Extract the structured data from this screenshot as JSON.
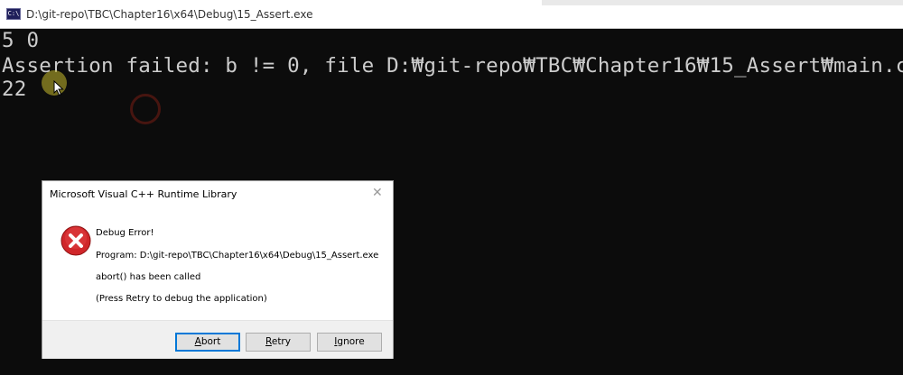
{
  "window": {
    "icon_text": "C:\\",
    "title": "D:\\git-repo\\TBC\\Chapter16\\x64\\Debug\\15_Assert.exe"
  },
  "console": {
    "lines": [
      "5 0",
      "Assertion failed: b != 0, file D:₩git-repo₩TBC₩Chapter16₩15_Assert₩main.c",
      "22"
    ]
  },
  "dialog": {
    "title": "Microsoft Visual C++ Runtime Library",
    "close_icon": "close-icon",
    "error_icon": "error-x-icon",
    "heading": "Debug Error!",
    "program": "Program: D:\\git-repo\\TBC\\Chapter16\\x64\\Debug\\15_Assert.exe",
    "message": "abort() has been called",
    "hint": "(Press Retry to debug the application)",
    "buttons": {
      "abort": {
        "mnemonic": "A",
        "rest": "bort"
      },
      "retry": {
        "mnemonic": "R",
        "rest": "etry"
      },
      "ignore": {
        "mnemonic": "I",
        "rest": "gnore"
      }
    }
  },
  "colors": {
    "console_bg": "#0c0c0c",
    "console_text": "#cccccc",
    "default_button_border": "#0078d7",
    "error_icon_red": "#d0262a"
  }
}
